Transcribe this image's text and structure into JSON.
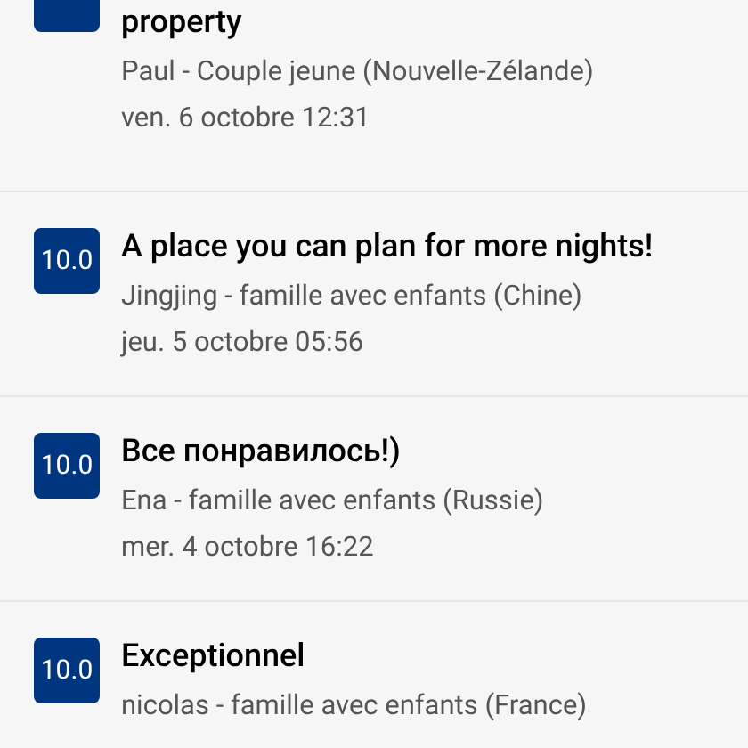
{
  "reviews": [
    {
      "title": "property",
      "reviewer": "Paul - Couple jeune (Nouvelle-Zélande)",
      "date": "ven. 6 octobre 12:31"
    },
    {
      "score": "10.0",
      "title": "A place you can plan for more nights!",
      "reviewer": "Jingjing - famille avec enfants (Chine)",
      "date": "jeu. 5 octobre 05:56"
    },
    {
      "score": "10.0",
      "title": "Все понравилось!)",
      "reviewer": "Ena - famille avec enfants (Russie)",
      "date": "mer. 4 octobre 16:22"
    },
    {
      "score": "10.0",
      "title": "Exceptionnel",
      "reviewer": "nicolas - famille avec enfants (France)"
    }
  ]
}
